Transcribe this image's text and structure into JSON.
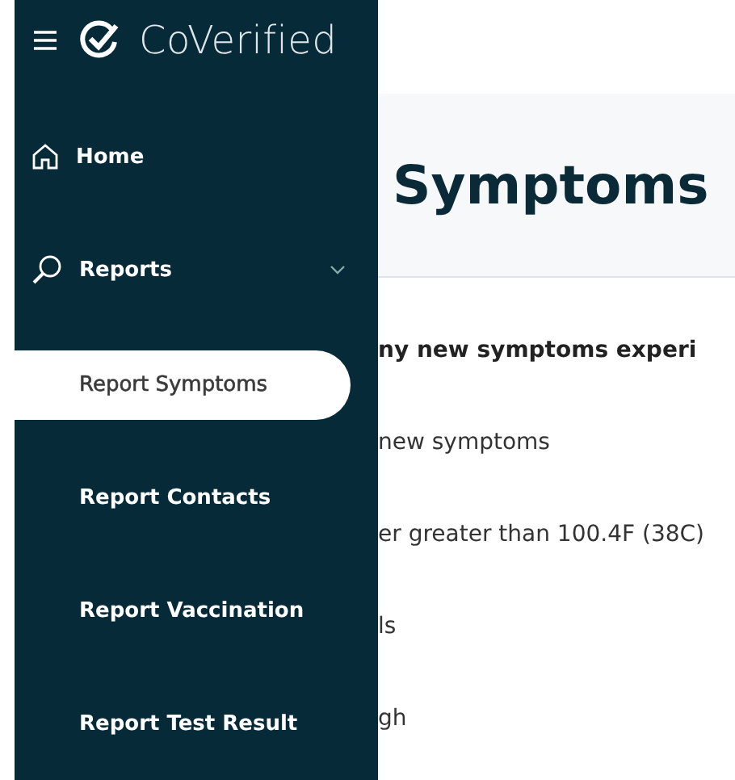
{
  "brand": {
    "name": "CoVerified"
  },
  "nav": [
    {
      "label": "Home",
      "kind": "home"
    },
    {
      "label": "Reports",
      "kind": "reports",
      "children": [
        {
          "label": "Report Symptoms",
          "selected": true
        },
        {
          "label": "Report Contacts",
          "selected": false
        },
        {
          "label": "Report Vaccination",
          "selected": false
        },
        {
          "label": "Report Test Result",
          "selected": false
        }
      ]
    }
  ],
  "page": {
    "title": "Symptoms",
    "question": "ny new symptoms experi",
    "options": [
      {
        "label": "new symptoms"
      },
      {
        "label": "er greater than 100.4F (38C)"
      },
      {
        "label": "ls"
      },
      {
        "label": "gh"
      }
    ]
  }
}
